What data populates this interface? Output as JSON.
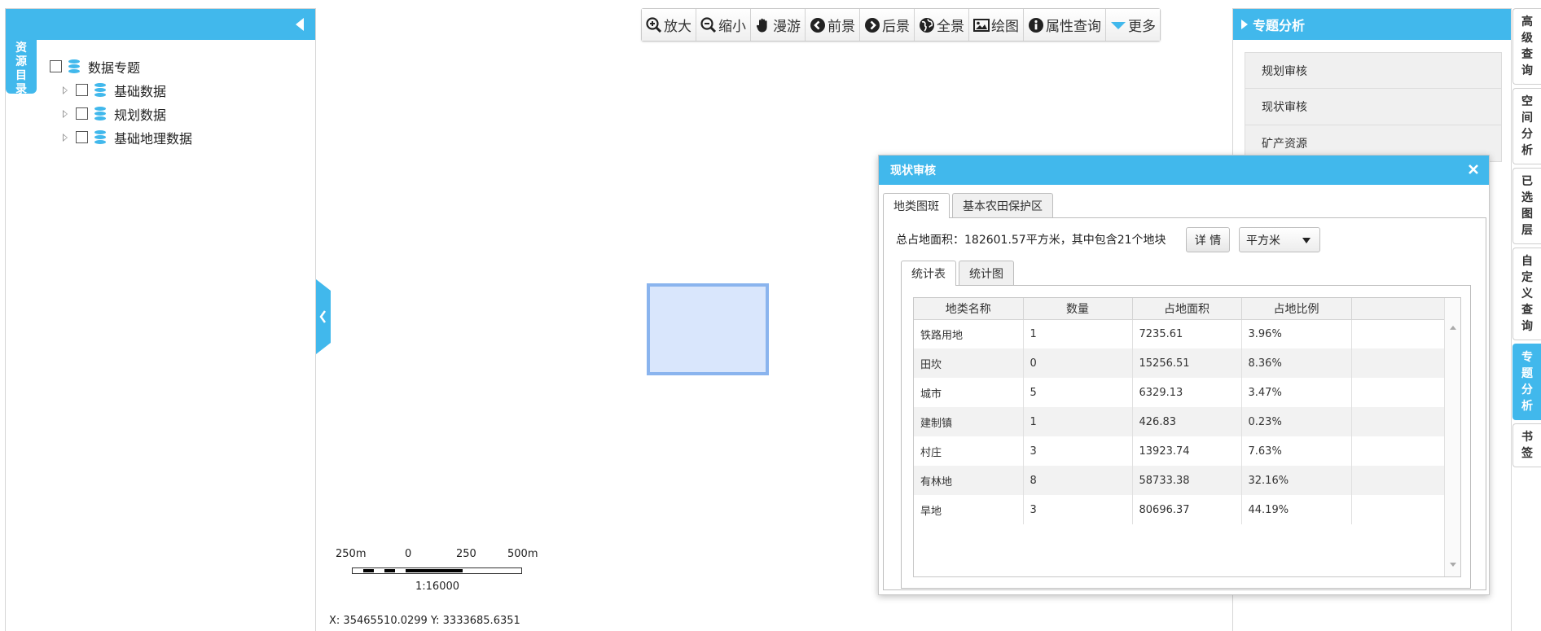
{
  "left_panel": {
    "vertical_tab": "资源目录",
    "tree": {
      "root": "数据专题",
      "children": [
        "基础数据",
        "规划数据",
        "基础地理数据"
      ]
    }
  },
  "toolbar": {
    "buttons": [
      {
        "label": "放大",
        "icon": "zoom-in-icon"
      },
      {
        "label": "缩小",
        "icon": "zoom-out-icon"
      },
      {
        "label": "漫游",
        "icon": "hand-icon"
      },
      {
        "label": "前景",
        "icon": "arrow-left-circle-icon"
      },
      {
        "label": "后景",
        "icon": "arrow-right-circle-icon"
      },
      {
        "label": "全景",
        "icon": "globe-icon"
      },
      {
        "label": "绘图",
        "icon": "image-icon"
      },
      {
        "label": "属性查询",
        "icon": "info-icon"
      },
      {
        "label": "更多",
        "icon": "caret-down-icon"
      }
    ]
  },
  "map": {
    "scale_labels": [
      "250m",
      "0",
      "250",
      "500m"
    ],
    "scale_ratio": "1:16000",
    "coordinates": "X: 35465510.0299 Y: 3333685.6351"
  },
  "right_panel": {
    "title": "专题分析",
    "items": [
      "规划审核",
      "现状审核",
      "矿产资源"
    ]
  },
  "side_tabs": [
    {
      "label": "高级查询",
      "active": false
    },
    {
      "label": "空间分析",
      "active": false
    },
    {
      "label": "已选图层",
      "active": false
    },
    {
      "label": "自定义查询",
      "active": false
    },
    {
      "label": "专题分析",
      "active": true
    },
    {
      "label": "书签",
      "active": false
    }
  ],
  "dialog": {
    "title": "现状审核",
    "tabs": [
      "地类图斑",
      "基本农田保护区"
    ],
    "summary": "总占地面积：182601.57平方米，其中包含21个地块",
    "detail_button": "详 情",
    "unit_select": "平方米",
    "inner_tabs": [
      "统计表",
      "统计图"
    ],
    "table": {
      "headers": [
        "地类名称",
        "数量",
        "占地面积",
        "占地比例"
      ],
      "rows": [
        [
          "铁路用地",
          "1",
          "7235.61",
          "3.96%"
        ],
        [
          "田坎",
          "0",
          "15256.51",
          "8.36%"
        ],
        [
          "城市",
          "5",
          "6329.13",
          "3.47%"
        ],
        [
          "建制镇",
          "1",
          "426.83",
          "0.23%"
        ],
        [
          "村庄",
          "3",
          "13923.74",
          "7.63%"
        ],
        [
          "有林地",
          "8",
          "58733.38",
          "32.16%"
        ],
        [
          "旱地",
          "3",
          "80696.37",
          "44.19%"
        ]
      ]
    }
  },
  "colors": {
    "accent": "#41b8ec",
    "polygon_fill": "#d9e6fc",
    "polygon_stroke": "#8ab4ee"
  }
}
